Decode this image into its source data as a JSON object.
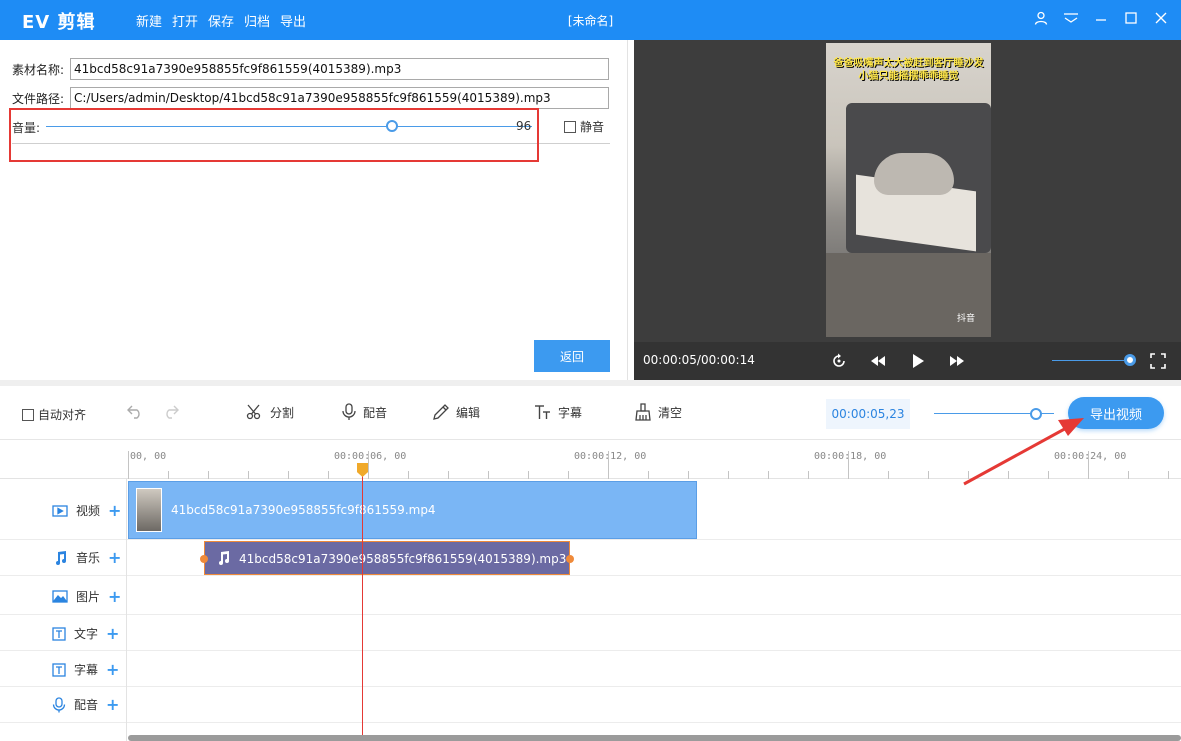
{
  "app": {
    "logo": "EV 剪辑",
    "window_title": "[未命名]",
    "menu": [
      "新建",
      "打开",
      "保存",
      "归档",
      "导出"
    ]
  },
  "properties": {
    "name_label": "素材名称:",
    "name_value": "41bcd58c91a7390e958855fc9f861559(4015389).mp3",
    "path_label": "文件路径:",
    "path_value": "C:/Users/admin/Desktop/41bcd58c91a7390e958855fc9f861559(4015389).mp3",
    "volume_label": "音量:",
    "volume_value": "96",
    "volume_level": 96,
    "mute_label": "静音",
    "mute_checked": false,
    "back_label": "返回"
  },
  "preview": {
    "caption": "爸爸吸嘴声太大被赶到客厅睡沙发 小猫只能摇摆乖乖睡觉",
    "watermark": "抖音",
    "time": "00:00:05/00:00:14"
  },
  "toolbar": {
    "auto_align_label": "自动对齐",
    "split_label": "分割",
    "dub_label": "配音",
    "edit_label": "编辑",
    "subtitle_label": "字幕",
    "clear_label": "清空",
    "current_time": "00:00:05,23",
    "export_label": "导出视频"
  },
  "timeline": {
    "ruler_ticks": [
      "00:00:00, 00",
      "00:00:06, 00",
      "00:00:12, 00",
      "00:00:18, 00",
      "00:00:24, 00"
    ],
    "ruler_first_visible": "00, 00",
    "tracks": [
      {
        "label": "视频",
        "icon": "video-icon"
      },
      {
        "label": "音乐",
        "icon": "music-icon"
      },
      {
        "label": "图片",
        "icon": "image-icon"
      },
      {
        "label": "文字",
        "icon": "text-icon"
      },
      {
        "label": "字幕",
        "icon": "subtitle-icon"
      },
      {
        "label": "配音",
        "icon": "mic-icon"
      }
    ],
    "video_clip": "41bcd58c91a7390e958855fc9f861559.mp4",
    "audio_clip": "41bcd58c91a7390e958855fc9f861559(4015389).mp3"
  },
  "colors": {
    "brand": "#1e8cf5",
    "accent": "#3c9af0",
    "highlight": "#e53935",
    "audio_clip": "#6b6aa3",
    "video_clip": "#7ab6f5"
  }
}
